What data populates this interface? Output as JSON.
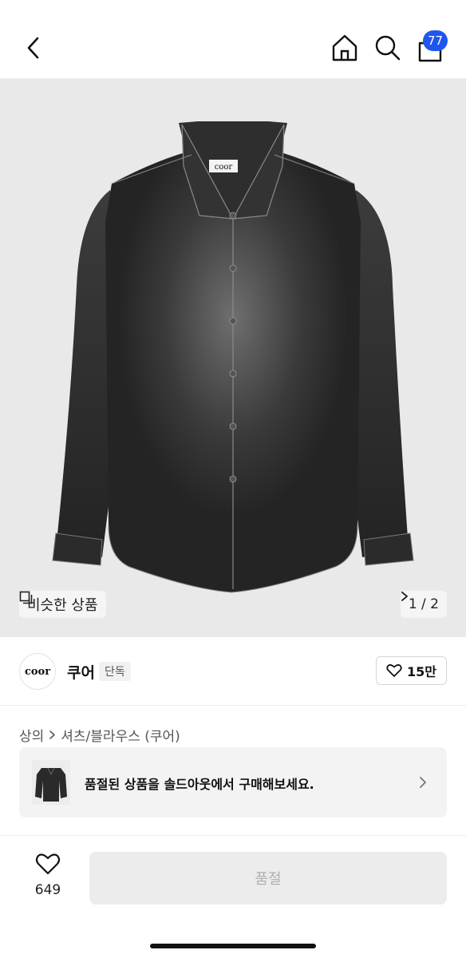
{
  "header": {
    "back_icon": "chevron-left-icon",
    "home_icon": "home-icon",
    "search_icon": "search-icon",
    "cart_icon": "bag-icon",
    "cart_count": "77",
    "badge_color": "#1f56f0"
  },
  "product_image": {
    "subject": "black washed denim shirt",
    "label_text": "coor",
    "similar_label": "비슷한 상품",
    "page_indicator": "1 / 2",
    "background_color": "#e9e9ea"
  },
  "brand": {
    "logo_text": "coor",
    "name": "쿠어",
    "tag": "단독",
    "like_count": "15만"
  },
  "breadcrumb": {
    "category": "상의",
    "subcategory": "셔츠/블라우스 (쿠어)"
  },
  "soldout_banner": {
    "message": "품절된 상품을 솔드아웃에서 구매해보세요."
  },
  "bottom_bar": {
    "wish_count": "649",
    "buy_label": "품절"
  }
}
